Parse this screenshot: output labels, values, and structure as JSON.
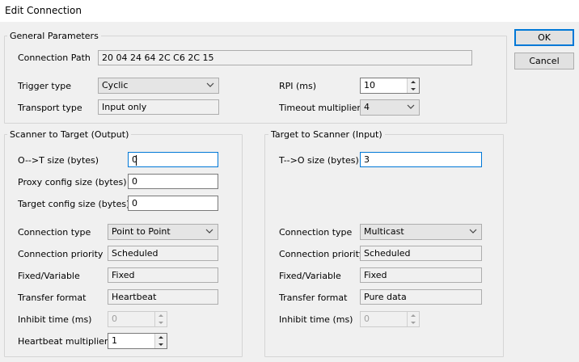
{
  "window": {
    "title": "Edit Connection"
  },
  "buttons": {
    "ok": "OK",
    "cancel": "Cancel"
  },
  "general": {
    "legend": "General Parameters",
    "connection_path_label": "Connection Path",
    "connection_path": "20 04 24 64 2C C6 2C 15",
    "trigger_type_label": "Trigger type",
    "trigger_type": "Cyclic",
    "transport_type_label": "Transport type",
    "transport_type": "Input only",
    "rpi_label": "RPI (ms)",
    "rpi": "10",
    "timeout_label": "Timeout multiplier",
    "timeout": "4"
  },
  "output": {
    "legend": "Scanner to Target (Output)",
    "ot_size_label": "O-->T size (bytes)",
    "ot_size": "0",
    "proxy_label": "Proxy config size (bytes)",
    "proxy": "0",
    "target_cfg_label": "Target config size (bytes)",
    "target_cfg": "0",
    "conn_type_label": "Connection type",
    "conn_type": "Point to Point",
    "conn_priority_label": "Connection priority",
    "conn_priority": "Scheduled",
    "fixed_var_label": "Fixed/Variable",
    "fixed_var": "Fixed",
    "transfer_label": "Transfer format",
    "transfer": "Heartbeat",
    "inhibit_label": "Inhibit time (ms)",
    "inhibit": "0",
    "heartbeat_label": "Heartbeat multiplier",
    "heartbeat": "1"
  },
  "input": {
    "legend": "Target to Scanner (Input)",
    "to_size_label": "T-->O size (bytes)",
    "to_size": "3",
    "conn_type_label": "Connection type",
    "conn_type": "Multicast",
    "conn_priority_label": "Connection priority",
    "conn_priority": "Scheduled",
    "fixed_var_label": "Fixed/Variable",
    "fixed_var": "Fixed",
    "transfer_label": "Transfer format",
    "transfer": "Pure data",
    "inhibit_label": "Inhibit time (ms)",
    "inhibit": "0"
  },
  "icons": {
    "combo_arrow": "chevron-down-icon",
    "spin_up": "spin-up-icon",
    "spin_down": "spin-down-icon"
  }
}
